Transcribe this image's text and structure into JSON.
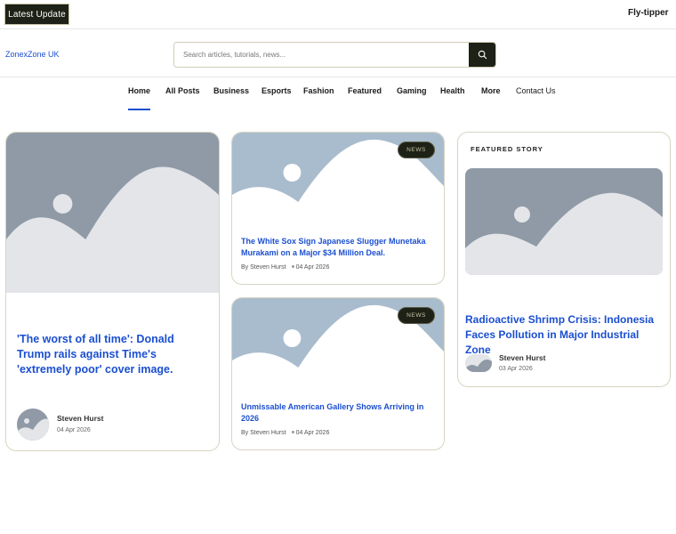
{
  "topbar": {
    "latest_label": "Latest Update",
    "ticker_text": "Fly-tipper"
  },
  "header": {
    "logo_text": "ZonexZone UK",
    "search_placeholder": "Search articles, tutorials, news..."
  },
  "nav": {
    "active": "Home",
    "items": [
      "Home",
      "All Posts",
      "Business",
      "Esports",
      "Fashion",
      "Featured",
      "Gaming",
      "Health",
      "More",
      "Contact Us"
    ]
  },
  "colors": {
    "accent": "#1b4fd0",
    "dark": "#1d2116",
    "border": "#d8d4c2"
  },
  "main_story": {
    "title": "'The worst of all time': Donald Trump rails against Time's 'extremely poor' cover image.",
    "author": "Steven Hurst",
    "date": "04 Apr 2026"
  },
  "side_stories": [
    {
      "badge": "NEWS",
      "title": "The White Sox Sign Japanese Slugger Munetaka Murakami on a Major $34 Million Deal.",
      "byline": "By Steven Hurst",
      "date": "04 Apr 2026"
    },
    {
      "badge": "NEWS",
      "title": "Unmissable American Gallery Shows Arriving in 2026",
      "byline": "By Steven Hurst",
      "date": "04 Apr 2026"
    }
  ],
  "featured": {
    "heading": "FEATURED STORY",
    "title": "Radioactive Shrimp Crisis: Indonesia Faces Pollution in Major Industrial Zone",
    "author": "Steven Hurst",
    "date": "03 Apr 2026"
  },
  "icons": {
    "search": "search-icon",
    "image_placeholder": "image-placeholder-icon"
  }
}
